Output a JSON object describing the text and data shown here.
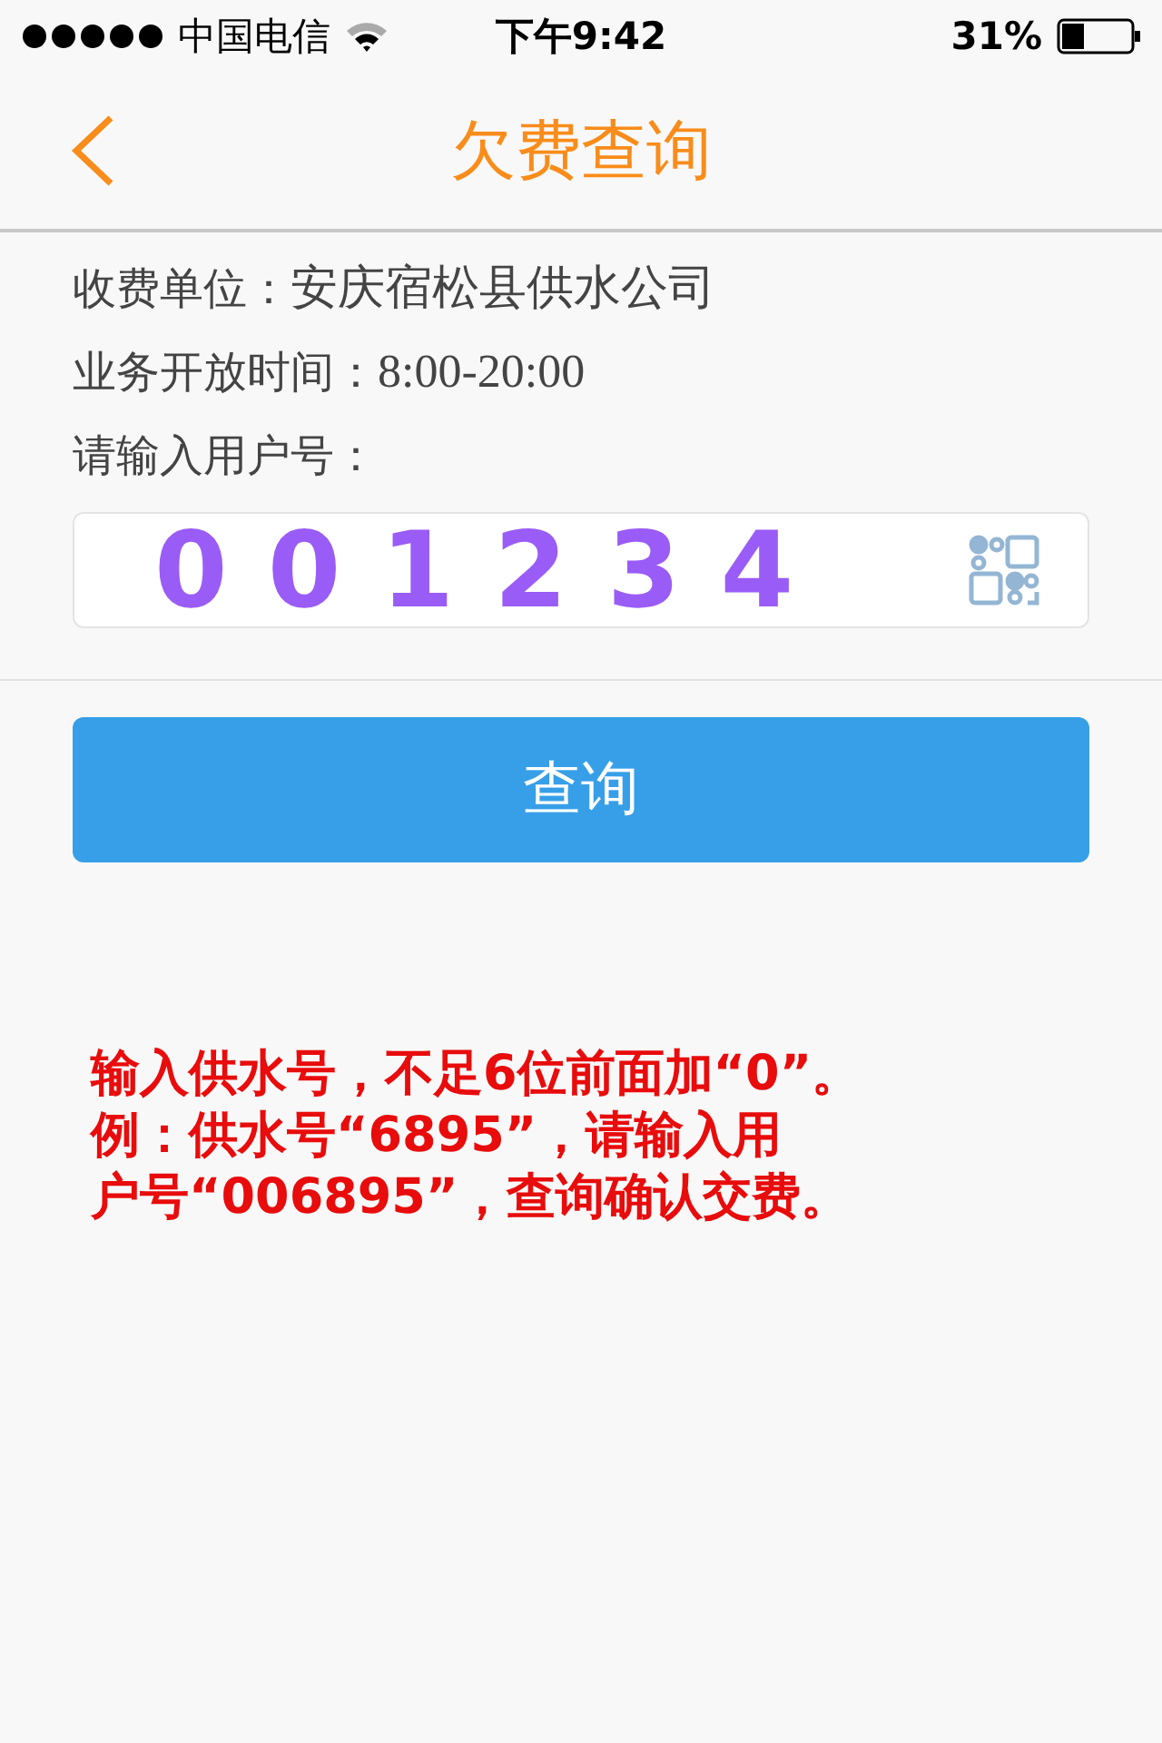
{
  "status_bar": {
    "carrier": "中国电信",
    "time": "下午9:42",
    "battery": "31%"
  },
  "nav": {
    "title": "欠费查询"
  },
  "info": [
    {
      "label": "收费单位：",
      "value": "安庆宿松县供水公司"
    },
    {
      "label": "业务开放时间：",
      "value": "8:00-20:00"
    }
  ],
  "account_field": {
    "label": "请输入用户号：",
    "value": "001234"
  },
  "query_button": "查询",
  "note": [
    "输入供水号，不足6位前面加“0”。",
    "例：供水号“6895”，请输入用",
    "户号“006895”，查询确认交费。"
  ]
}
